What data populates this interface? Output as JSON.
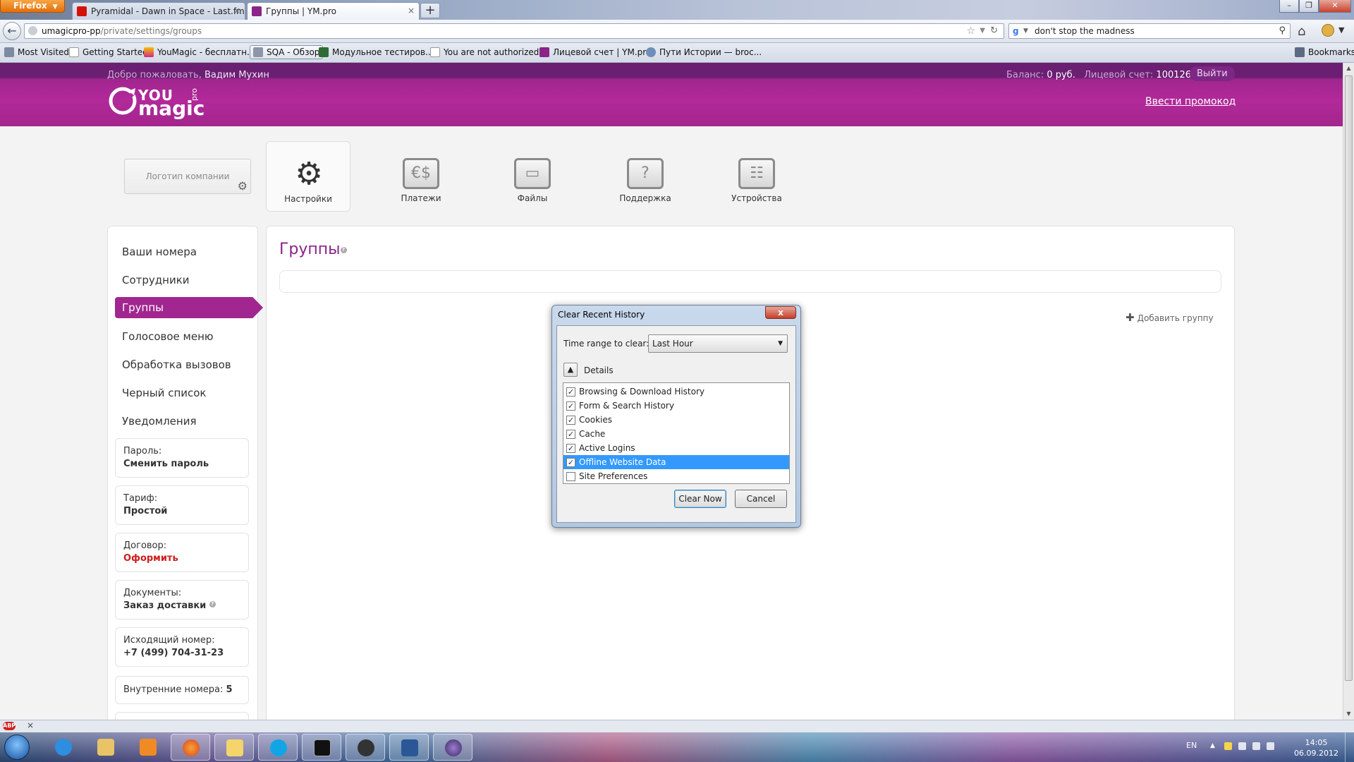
{
  "browser": {
    "menu_label": "Firefox",
    "tabs": [
      {
        "title": "Pyramidal - Dawn in Space - Last.fm",
        "favicon": "lastfm-icon",
        "color": "#d51007"
      },
      {
        "title": "Группы | YM.pro",
        "favicon": "youmagic-icon",
        "color": "#8b2389"
      }
    ],
    "new_tab": "+",
    "url_host": "umagicpro-pp",
    "url_path": "/private/settings/groups",
    "search_text": "don't stop the madness",
    "bookmarks": [
      {
        "label": "Most Visited",
        "icon": "gear-icon"
      },
      {
        "label": "Getting Started",
        "icon": "page-icon"
      },
      {
        "label": "YouMagic - бесплатн...",
        "icon": "youmagic-icon"
      },
      {
        "label": "SQA - Обзор",
        "icon": "sqa-icon"
      },
      {
        "label": "Модульное тестиров...",
        "icon": "green-icon"
      },
      {
        "label": "You are not authorized...",
        "icon": "page-icon"
      },
      {
        "label": "Лицевой счет | YM.pro",
        "icon": "youmagic-icon"
      },
      {
        "label": "Пути Истории — broc...",
        "icon": "globe-icon"
      }
    ],
    "bookmarks_menu": "Bookmarks"
  },
  "header": {
    "welcome_prefix": "Добро пожаловать,",
    "user_name": "Вадим Мухин",
    "balance_label": "Баланс:",
    "balance_value": "0 руб.",
    "account_label": "Лицевой счет:",
    "account_value": "100126",
    "logout": "Выйти",
    "logo_text_1": "YOU",
    "logo_text_2": "magic",
    "logo_text_3": "pro",
    "promo": "Ввести промокод"
  },
  "company_logo_placeholder": "Логотип компании",
  "top_nav": [
    {
      "label": "Настройки",
      "icon": "settings-icon"
    },
    {
      "label": "Платежи",
      "icon": "payments-icon"
    },
    {
      "label": "Файлы",
      "icon": "files-icon"
    },
    {
      "label": "Поддержка",
      "icon": "support-icon"
    },
    {
      "label": "Устройства",
      "icon": "devices-icon"
    }
  ],
  "sidebar": {
    "items": [
      "Ваши номера",
      "Сотрудники",
      "Группы",
      "Голосовое меню",
      "Обработка вызовов",
      "Черный список",
      "Уведомления"
    ],
    "cards": [
      {
        "label": "Пароль:",
        "value": "Сменить пароль"
      },
      {
        "label": "Тариф:",
        "value": "Простой"
      },
      {
        "label": "Договор:",
        "value": "Оформить"
      },
      {
        "label": "Документы:",
        "value": "Заказ доставки"
      },
      {
        "label": "Исходящий номер:",
        "value": "+7 (499) 704-31-23"
      }
    ],
    "internal_label": "Внутренние номера:",
    "internal_value": "5"
  },
  "main": {
    "title": "Группы",
    "add_group": "Добавить группу"
  },
  "dialog": {
    "title": "Clear Recent History",
    "close": "x",
    "time_range_label": "Time range to clear:",
    "time_range_value": "Last Hour",
    "details_label": "Details",
    "items": [
      {
        "label": "Browsing & Download History",
        "checked": true
      },
      {
        "label": "Form & Search History",
        "checked": true
      },
      {
        "label": "Cookies",
        "checked": true
      },
      {
        "label": "Cache",
        "checked": true
      },
      {
        "label": "Active Logins",
        "checked": true
      },
      {
        "label": "Offline Website Data",
        "checked": true,
        "selected": true
      },
      {
        "label": "Site Preferences",
        "checked": false
      }
    ],
    "clear_now": "Clear Now",
    "cancel": "Cancel"
  },
  "taskbar": {
    "language": "EN",
    "time": "14:05",
    "date": "06.09.2012"
  },
  "colors": {
    "brand": "#a1268f",
    "brand_dark": "#6b1f73",
    "selection": "#3399ff",
    "red_link": "#d01b1b"
  }
}
